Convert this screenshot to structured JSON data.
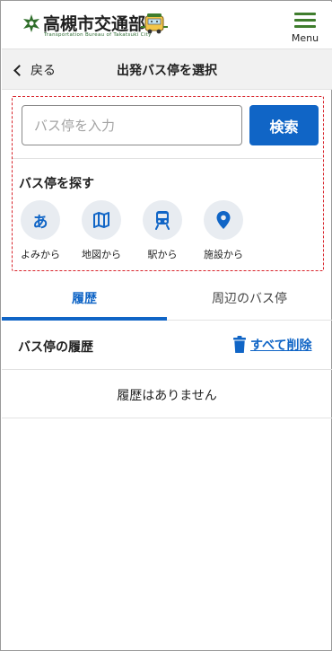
{
  "header": {
    "logo_title": "高槻市交通部",
    "logo_subtitle": "Transportation Bureau of Takatsuki City",
    "menu_label": "Menu",
    "accent_color": "#3f7d2d"
  },
  "titlebar": {
    "back_label": "戻る",
    "title": "出発バス停を選択"
  },
  "search": {
    "placeholder": "バス停を入力",
    "value": "",
    "button_label": "検索",
    "button_color": "#1065c6"
  },
  "find": {
    "heading": "バス停を探す",
    "items": [
      {
        "icon": "hiragana-a-icon",
        "glyph": "あ",
        "label": "よみから"
      },
      {
        "icon": "map-icon",
        "label": "地図から"
      },
      {
        "icon": "train-icon",
        "label": "駅から"
      },
      {
        "icon": "location-pin-icon",
        "label": "施設から"
      }
    ]
  },
  "tabs": [
    {
      "label": "履歴",
      "active": true
    },
    {
      "label": "周辺のバス停",
      "active": false
    }
  ],
  "history": {
    "title": "バス停の履歴",
    "delete_all_label": "すべて削除",
    "empty_message": "履歴はありません"
  }
}
